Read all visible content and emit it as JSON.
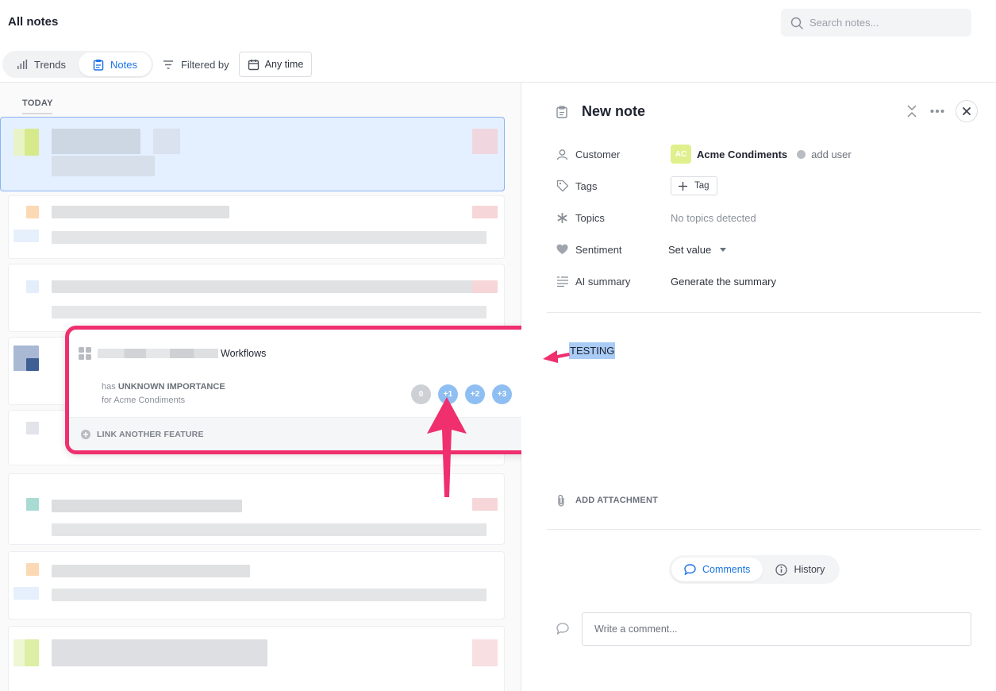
{
  "header": {
    "title": "All notes",
    "search_placeholder": "Search notes..."
  },
  "toolbar": {
    "trends_label": "Trends",
    "notes_label": "Notes",
    "filtered_label": "Filtered by",
    "time_filter": "Any time"
  },
  "list": {
    "section_label": "TODAY"
  },
  "popover": {
    "feature_name": "Workflows",
    "importance_prefix": "has",
    "importance_value": "UNKNOWN IMPORTANCE",
    "for_customer": "for Acme Condiments",
    "importance_options": [
      {
        "label": "0",
        "color": "#cdd0d4"
      },
      {
        "label": "+1",
        "color": "#8fbff2"
      },
      {
        "label": "+2",
        "color": "#8fbff2"
      },
      {
        "label": "+3",
        "color": "#8fbff2"
      }
    ],
    "link_label": "LINK ANOTHER FEATURE"
  },
  "note": {
    "title": "New note",
    "properties": {
      "customer_label": "Customer",
      "customer_initials": "AC",
      "customer_name": "Acme Condiments",
      "add_user_label": "add user",
      "tags_label": "Tags",
      "tag_button": "Tag",
      "topics_label": "Topics",
      "topics_value": "No topics detected",
      "sentiment_label": "Sentiment",
      "sentiment_value": "Set value",
      "ai_summary_label": "AI summary",
      "ai_summary_value": "Generate the summary"
    },
    "body": "TESTING",
    "attachment_label": "ADD ATTACHMENT",
    "tabs": [
      {
        "label": "Comments",
        "active": true
      },
      {
        "label": "History",
        "active": false
      }
    ],
    "comment_placeholder": "Write a comment..."
  },
  "colors": {
    "accent": "#1a73e8",
    "annotation": "#ef2f6e"
  }
}
